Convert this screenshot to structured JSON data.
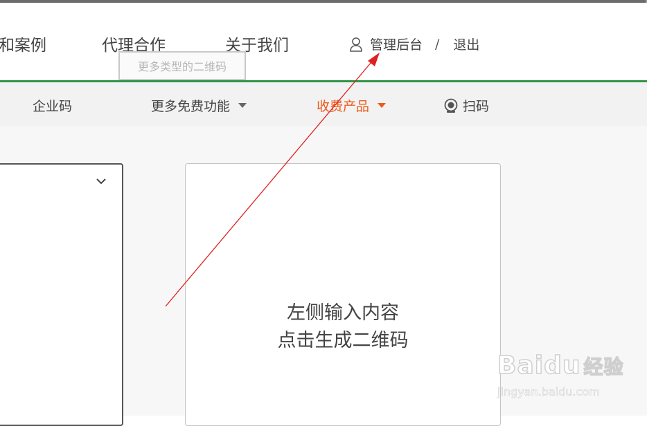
{
  "topnav": {
    "items": [
      {
        "label": "和案例"
      },
      {
        "label": "代理合作"
      },
      {
        "label": "关于我们"
      }
    ],
    "admin_label": "管理后台",
    "separator": "/",
    "logout_label": "退出",
    "tooltip": "更多类型的二维码"
  },
  "subnav": {
    "items": [
      {
        "label": "企业码",
        "has_caret": false
      },
      {
        "label": "更多免费功能",
        "has_caret": true
      },
      {
        "label": "收费产品",
        "has_caret": true,
        "active": true
      },
      {
        "label": "扫码",
        "icon": "camera-icon"
      }
    ]
  },
  "preview": {
    "line1": "左侧输入内容",
    "line2": "点击生成二维码"
  },
  "watermark": {
    "logo": "Bai",
    "logo_mid": "du",
    "logo_tail": "经验",
    "url": "jingyan.baidu.com"
  },
  "colors": {
    "accent_green": "#2f9448",
    "active_orange": "#ee5a1c",
    "annotation_red": "#e02020"
  }
}
